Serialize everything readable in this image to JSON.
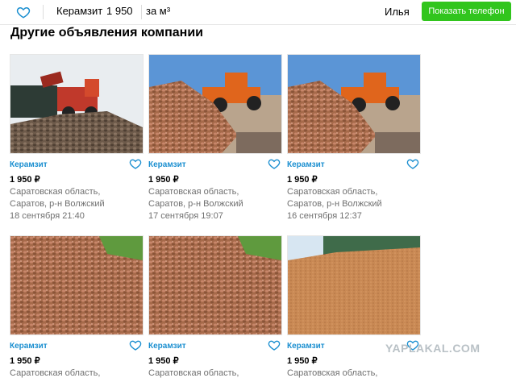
{
  "header": {
    "title": "Керамзит",
    "price": "1 950",
    "unit": "за м³",
    "seller": "Илья",
    "phone_button": "Показать телефон"
  },
  "section_title": "Другие объявления компании",
  "listings": [
    {
      "title": "Керамзит",
      "price": "1 950 ₽",
      "address_line1": "Саратовская область,",
      "address_line2": "Саратов, р-н Волжский",
      "date": "18 сентября 21:40"
    },
    {
      "title": "Керамзит",
      "price": "1 950 ₽",
      "address_line1": "Саратовская область,",
      "address_line2": "Саратов, р-н Волжский",
      "date": "17 сентября 19:07"
    },
    {
      "title": "Керамзит",
      "price": "1 950 ₽",
      "address_line1": "Саратовская область,",
      "address_line2": "Саратов, р-н Волжский",
      "date": "16 сентября 12:37"
    },
    {
      "title": "Керамзит",
      "price": "1 950 ₽",
      "address_line1": "Саратовская область,",
      "address_line2": "",
      "date": ""
    },
    {
      "title": "Керамзит",
      "price": "1 950 ₽",
      "address_line1": "Саратовская область,",
      "address_line2": "",
      "date": ""
    },
    {
      "title": "Керамзит",
      "price": "1 950 ₽",
      "address_line1": "Саратовская область,",
      "address_line2": "",
      "date": ""
    }
  ],
  "watermark": "YAPLAKAL.COM",
  "colors": {
    "accent_green": "#31c51d",
    "link_blue": "#1b8fd0",
    "heart_blue": "#1b8fd0"
  }
}
